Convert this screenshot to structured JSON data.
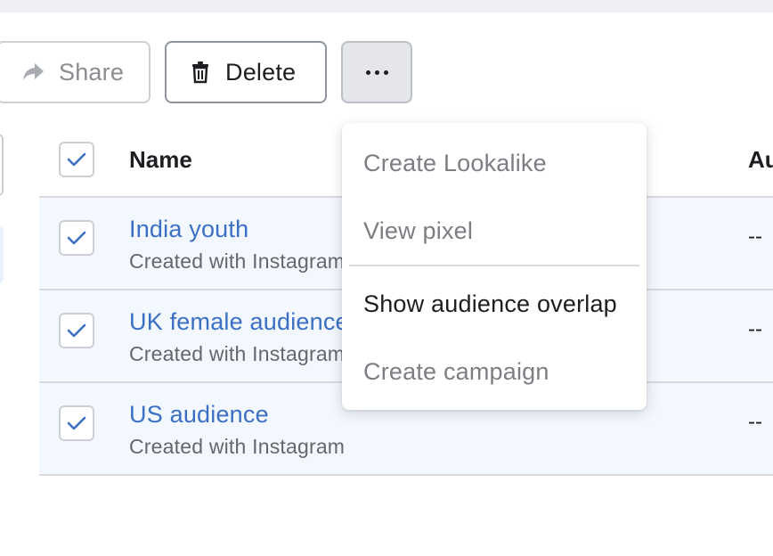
{
  "toolbar": {
    "share_label": "Share",
    "delete_label": "Delete",
    "share_icon": "share-arrow-icon",
    "delete_icon": "trash-icon",
    "more_icon": "ellipsis-icon"
  },
  "table": {
    "columns": [
      "Name",
      "Au"
    ],
    "rows": [
      {
        "name": "India youth",
        "subtitle": "Created with Instagram",
        "value": "--",
        "checked": true
      },
      {
        "name": "UK female audience",
        "subtitle": "Created with Instagram",
        "value": "--",
        "checked": true
      },
      {
        "name": "US audience",
        "subtitle": "Created with Instagram",
        "value": "--",
        "checked": true
      }
    ],
    "header_checked": true
  },
  "menu": {
    "items": [
      {
        "label": "Create Lookalike",
        "enabled": false
      },
      {
        "label": "View pixel",
        "enabled": false
      },
      {
        "label": "Show audience overlap",
        "enabled": true
      },
      {
        "label": "Create campaign",
        "enabled": false
      }
    ]
  },
  "colors": {
    "accent": "#3b6fc4",
    "selected_row_bg": "#f3f8fe",
    "border": "#d8dadf"
  }
}
